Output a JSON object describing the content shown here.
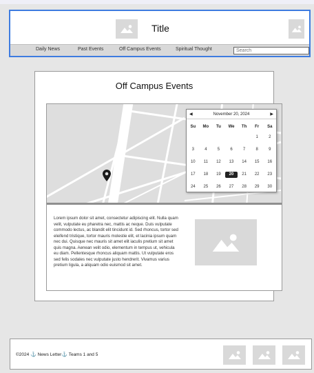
{
  "header": {
    "title": "Title",
    "nav": [
      {
        "label": "Daily News"
      },
      {
        "label": "Past Events"
      },
      {
        "label": "Off Campus Events"
      },
      {
        "label": "Spiritual Thought"
      }
    ],
    "search_placeholder": "Search"
  },
  "main": {
    "heading": "Off Campus Events",
    "calendar": {
      "month_label": "November 20, 2024",
      "prev_glyph": "◀",
      "next_glyph": "▶",
      "weekdays": [
        "Su",
        "Mo",
        "Tu",
        "We",
        "Th",
        "Fr",
        "Sa"
      ],
      "weeks": [
        [
          "",
          "",
          "",
          "",
          "",
          "1",
          "2"
        ],
        [
          "3",
          "4",
          "5",
          "6",
          "7",
          "8",
          "9"
        ],
        [
          "10",
          "11",
          "12",
          "13",
          "14",
          "15",
          "16"
        ],
        [
          "17",
          "18",
          "19",
          "20",
          "21",
          "22",
          "23"
        ],
        [
          "24",
          "25",
          "26",
          "27",
          "28",
          "29",
          "30"
        ]
      ],
      "selected_day": "20"
    },
    "body_text": "Lorem ipsum dolor sit amet, consectetur adipiscing elit. Nulla quam velit, vulputate eu pharetra nec, mattis ac neque. Duis vulputate commodo lectus, ac blandit elit tincidunt id. Sed rhoncus, tortor sed eleifend tristique, tortor mauris molestie elit, et lacinia ipsum quam nec dui. Quisque nec mauris sit amet elit iaculis pretium sit amet quis magna. Aenean velit odio, elementum in tempus ut, vehicula eu diam. Pellentesque rhoncus aliquam mattis. Ut vulputate eros sed felis sodales nec vulputate justo hendrerit. Vivamus varius pretium ligula, a aliquam odio euismod sit amet."
  },
  "footer": {
    "copyright": "©2024",
    "newsletter": "News Letter",
    "teams": "Teams 1 and 5",
    "anchor_glyph": "⚓"
  },
  "colors": {
    "header_border": "#3d7be0",
    "placeholder_gray": "#d9d9d9",
    "page_background": "#e6e6e6"
  }
}
